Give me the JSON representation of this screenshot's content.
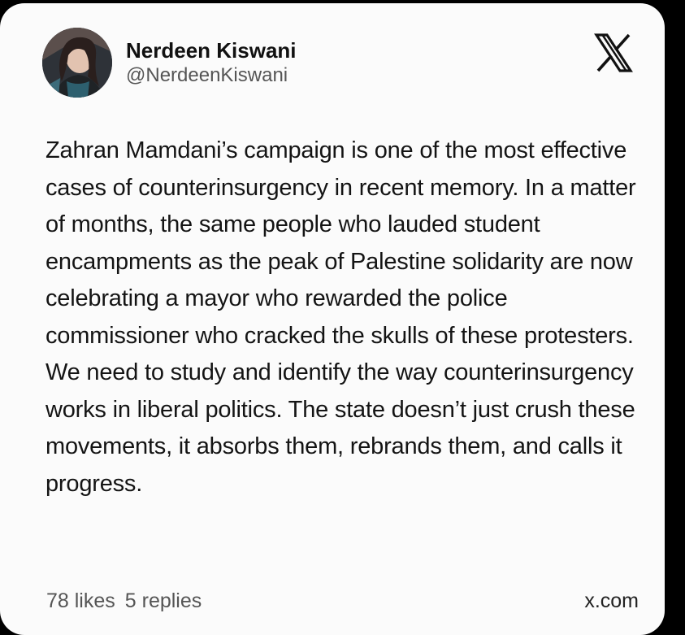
{
  "post": {
    "author": {
      "display_name": "Nerdeen Kiswani",
      "handle": "@NerdeenKiswani",
      "avatar_icon": "profile-photo"
    },
    "platform_icon": "x-logo-icon",
    "text": "Zahran Mamdani’s campaign is one of the most effective cases of counterinsurgency in recent memory. In a matter of months, the same people who lauded student encampments as the peak of Palestine solidarity are now celebrating a mayor who rewarded the police commissioner who cracked the skulls of these protesters. We need to study and identify the way counterinsurgency works in liberal politics. The state doesn’t just crush these movements, it absorbs them, rebrands them, and calls it progress.",
    "stats": {
      "likes": "78 likes",
      "replies": "5 replies"
    },
    "source": "x.com"
  },
  "colors": {
    "background": "#000000",
    "card": "#fbfbfb",
    "text": "#141414",
    "muted": "#555555"
  }
}
